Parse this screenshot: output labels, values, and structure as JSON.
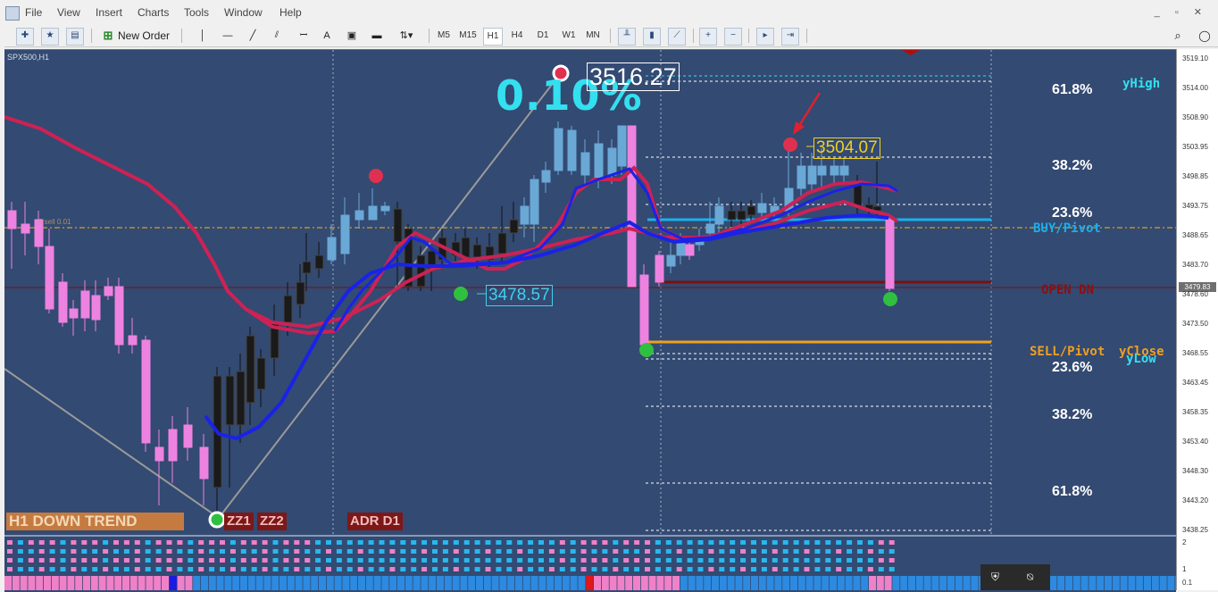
{
  "menu": {
    "items": [
      "File",
      "View",
      "Insert",
      "Charts",
      "Tools",
      "Window",
      "Help"
    ],
    "window_buttons": [
      "_",
      "▫",
      "✕"
    ]
  },
  "toolbar": {
    "new_order_label": "New Order",
    "timeframes": [
      "M5",
      "M15",
      "H1",
      "H4",
      "D1",
      "W1",
      "MN"
    ],
    "active_timeframe": "H1"
  },
  "chart": {
    "symbol_label": "SPX500,H1",
    "percent_label": "0.10%",
    "high_price_label": "3516.27",
    "recent_high_label": "3504.07",
    "swing_low_label": "3478.57",
    "hidden_line_label": "8 sell 0.01",
    "labels": {
      "yhigh": "yHigh",
      "buy_pivot": "BUY/Pivot",
      "open_dn": "OPEN DN",
      "sell_pivot": "SELL/Pivot",
      "yclose": "yClose",
      "ylow": "yLow"
    },
    "fib_levels": [
      "61.8%",
      "38.2%",
      "23.6%",
      "23.6%",
      "38.2%",
      "61.8%"
    ],
    "tags": {
      "trend": "H1 DOWN TREND",
      "zz1": "ZZ1",
      "zz2": "ZZ2",
      "adr": "ADR D1"
    },
    "colors": {
      "background": "#334a72",
      "bull_candle": "#6aa8d6",
      "bear_candle": "#ee82e0",
      "dark_candle": "#1a1a1a",
      "ma_fast": "#cc2255",
      "ma_slow": "#1a22e8",
      "buy_pivot": "#1ab0ee",
      "open_dn": "#8a1010",
      "sell_pivot": "#f0a020",
      "zigzag": "#9a9a9a"
    }
  },
  "price_axis": {
    "labels": [
      "3519.10",
      "3514.00",
      "3508.90",
      "3503.95",
      "3498.85",
      "3493.75",
      "3488.65",
      "3483.70",
      "3478.60",
      "3473.50",
      "3468.55",
      "3463.45",
      "3458.35",
      "3453.40",
      "3448.30",
      "3443.20",
      "3438.25"
    ],
    "current_price": "3479.83"
  },
  "indicator_axis": {
    "labels": [
      "2",
      "1",
      "0.1"
    ]
  }
}
